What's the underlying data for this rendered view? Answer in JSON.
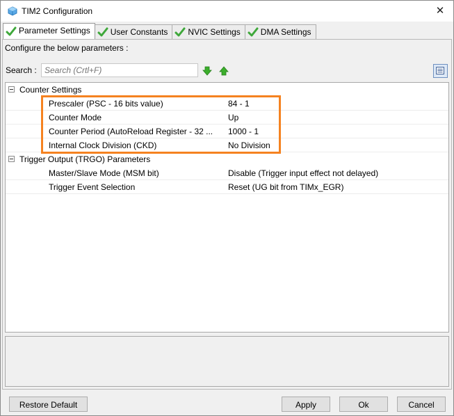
{
  "window": {
    "title": "TIM2 Configuration",
    "close_glyph": "✕"
  },
  "tabs": [
    {
      "label": "Parameter Settings",
      "active": true,
      "icon": "check-icon"
    },
    {
      "label": "User Constants",
      "active": false,
      "icon": "check-icon"
    },
    {
      "label": "NVIC Settings",
      "active": false,
      "icon": "check-icon"
    },
    {
      "label": "DMA Settings",
      "active": false,
      "icon": "check-icon"
    }
  ],
  "panel": {
    "description": "Configure the below parameters :"
  },
  "search": {
    "label": "Search :",
    "placeholder": "Search (Crtl+F)"
  },
  "groups": [
    {
      "label": "Counter Settings",
      "params": [
        {
          "name": "Prescaler (PSC - 16 bits value)",
          "value": "84 - 1"
        },
        {
          "name": "Counter Mode",
          "value": "Up"
        },
        {
          "name": "Counter Period (AutoReload Register - 32 ...",
          "value": "1000 - 1"
        },
        {
          "name": "Internal Clock Division (CKD)",
          "value": "No Division"
        }
      ]
    },
    {
      "label": "Trigger Output (TRGO) Parameters",
      "params": [
        {
          "name": "Master/Slave Mode (MSM bit)",
          "value": "Disable (Trigger input effect not delayed)"
        },
        {
          "name": "Trigger Event Selection",
          "value": "Reset (UG bit from TIMx_EGR)"
        }
      ]
    }
  ],
  "buttons": {
    "restore_default": "Restore Default",
    "apply": "Apply",
    "ok": "Ok",
    "cancel": "Cancel"
  },
  "colors": {
    "highlight": "#f58220",
    "check": "#3ea83a",
    "arrow": "#3cae2c"
  }
}
